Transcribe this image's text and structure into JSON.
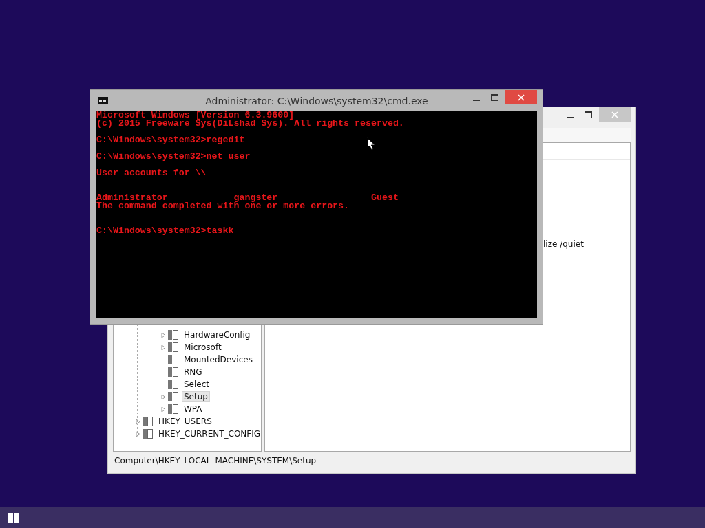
{
  "registry_window": {
    "tree_items": [
      {
        "label": "HardwareConfig",
        "expandable": true,
        "selected": false
      },
      {
        "label": "Microsoft",
        "expandable": true,
        "selected": false
      },
      {
        "label": "MountedDevices",
        "expandable": false,
        "selected": false
      },
      {
        "label": "RNG",
        "expandable": false,
        "selected": false
      },
      {
        "label": "Select",
        "expandable": false,
        "selected": false
      },
      {
        "label": "Setup",
        "expandable": true,
        "selected": true
      },
      {
        "label": "WPA",
        "expandable": true,
        "selected": false
      }
    ],
    "root_items": [
      {
        "label": "HKEY_USERS",
        "expandable": true,
        "selected": false
      },
      {
        "label": "HKEY_CURRENT_CONFIG",
        "expandable": true,
        "selected": false
      }
    ],
    "value_text": "lize /quiet",
    "status_bar": "Computer\\HKEY_LOCAL_MACHINE\\SYSTEM\\Setup"
  },
  "cmd_window": {
    "title": "Administrator: C:\\Windows\\system32\\cmd.exe",
    "lines": [
      {
        "kind": "text",
        "text": "Microsoft Windows [Version 6.3.9600]"
      },
      {
        "kind": "text",
        "text": "(c) 2015 Freeware Sys(DiLshad Sys). All rights reserved."
      },
      {
        "kind": "blank"
      },
      {
        "kind": "text",
        "text": "C:\\Windows\\system32>regedit"
      },
      {
        "kind": "blank"
      },
      {
        "kind": "text",
        "text": "C:\\Windows\\system32>net user"
      },
      {
        "kind": "blank"
      },
      {
        "kind": "text",
        "text": "User accounts for \\\\"
      },
      {
        "kind": "blank"
      },
      {
        "kind": "rule"
      },
      {
        "kind": "columns",
        "cells": [
          "Administrator",
          "gangster",
          "Guest"
        ]
      },
      {
        "kind": "text",
        "text": "The command completed with one or more errors."
      },
      {
        "kind": "blank"
      },
      {
        "kind": "blank"
      },
      {
        "kind": "text",
        "text": "C:\\Windows\\system32>taskk"
      }
    ]
  }
}
